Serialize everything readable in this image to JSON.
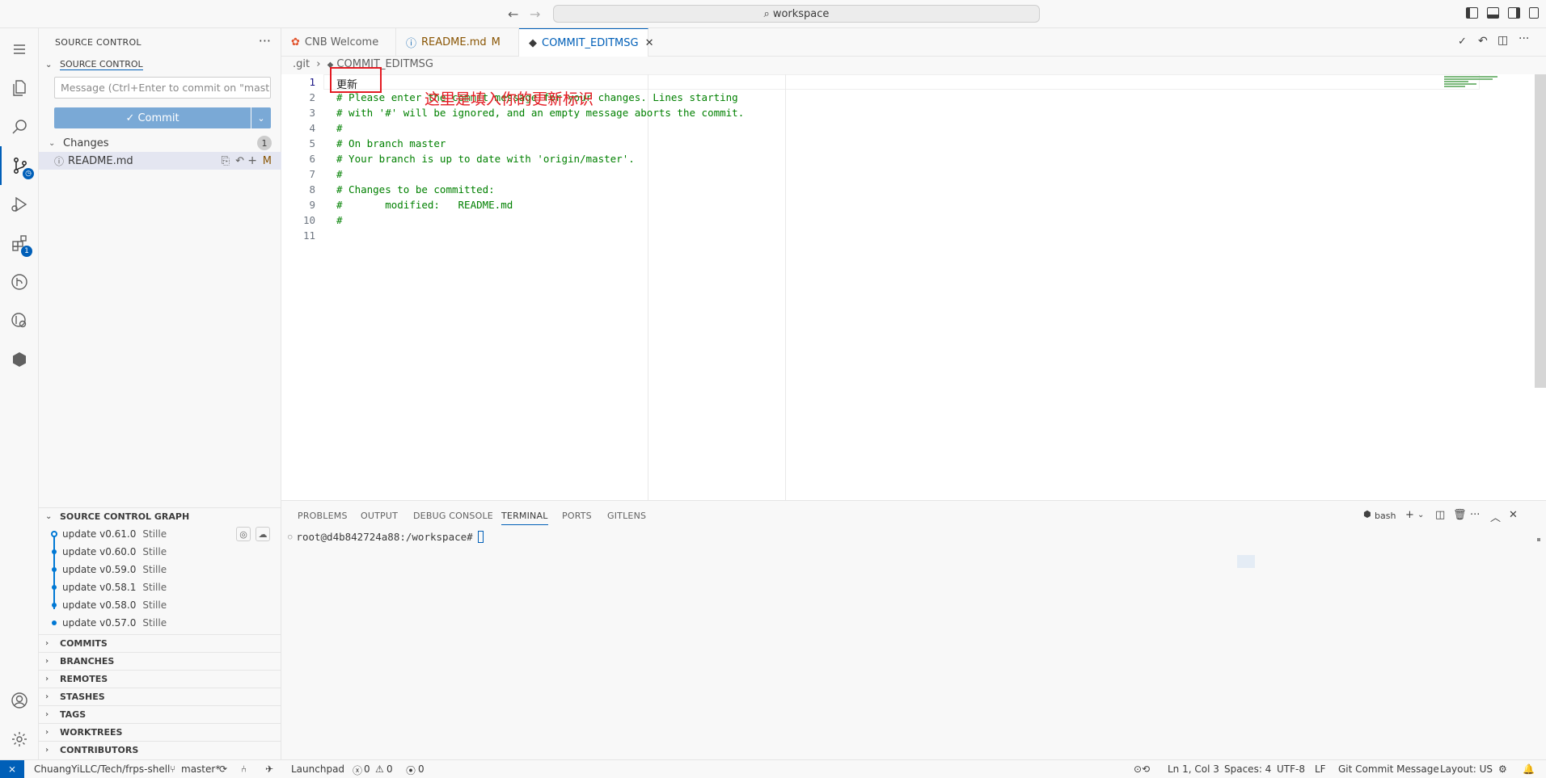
{
  "titlebar": {
    "search_text": "workspace"
  },
  "activity": {
    "extensions_badge": "1"
  },
  "sidebar": {
    "header": "SOURCE CONTROL",
    "section_title": "SOURCE CONTROL",
    "message_placeholder": "Message (Ctrl+Enter to commit on \"mast...",
    "commit_label": "✓ Commit",
    "changes_label": "Changes",
    "changes_count": "1",
    "changed_file": "README.md",
    "changed_file_status": "M"
  },
  "graph": {
    "title": "SOURCE CONTROL GRAPH",
    "commits": [
      {
        "msg": "update v0.61.0",
        "author": "Stille"
      },
      {
        "msg": "update v0.60.0",
        "author": "Stille"
      },
      {
        "msg": "update v0.59.0",
        "author": "Stille"
      },
      {
        "msg": "update v0.58.1",
        "author": "Stille"
      },
      {
        "msg": "update v0.58.0",
        "author": "Stille"
      },
      {
        "msg": "update v0.57.0",
        "author": "Stille"
      }
    ]
  },
  "gitlens_sections": [
    "COMMITS",
    "BRANCHES",
    "REMOTES",
    "STASHES",
    "TAGS",
    "WORKTREES",
    "CONTRIBUTORS"
  ],
  "tabs": {
    "welcome": "CNB Welcome",
    "readme": "README.md",
    "readme_status": "M",
    "commit_msg": "COMMIT_EDITMSG"
  },
  "breadcrumb": {
    "folder": ".git",
    "file": "COMMIT_EDITMSG"
  },
  "editor": {
    "lines": [
      {
        "n": "1",
        "text": "更新"
      },
      {
        "n": "2",
        "text": "# Please enter the commit message for your changes. Lines starting"
      },
      {
        "n": "3",
        "text": "# with '#' will be ignored, and an empty message aborts the commit."
      },
      {
        "n": "4",
        "text": "#"
      },
      {
        "n": "5",
        "text": "# On branch master"
      },
      {
        "n": "6",
        "text": "# Your branch is up to date with 'origin/master'."
      },
      {
        "n": "7",
        "text": "#"
      },
      {
        "n": "8",
        "text": "# Changes to be committed:"
      },
      {
        "n": "9",
        "text": "#\tmodified:   README.md"
      },
      {
        "n": "10",
        "text": "#"
      },
      {
        "n": "11",
        "text": ""
      }
    ],
    "annotation": "这里是填入你的更新标识"
  },
  "panel": {
    "tabs": [
      "PROBLEMS",
      "OUTPUT",
      "DEBUG CONSOLE",
      "TERMINAL",
      "PORTS",
      "GITLENS"
    ],
    "active_tab": "TERMINAL",
    "shell": "bash",
    "prompt": "root@d4b842724a88:/workspace#"
  },
  "statusbar": {
    "repo": "ChuangYiLLC/Tech/frps-shell",
    "branch": "master*",
    "launchpad": "Launchpad",
    "errors": "0",
    "warnings": "0",
    "ports": "0",
    "position": "Ln 1, Col 3",
    "spaces": "Spaces: 4",
    "encoding": "UTF-8",
    "eol": "LF",
    "language": "Git Commit Message",
    "layout": "Layout: US"
  },
  "colors": {
    "accent": "#005fb8",
    "comment": "#008000",
    "annotation": "#e31b23"
  }
}
